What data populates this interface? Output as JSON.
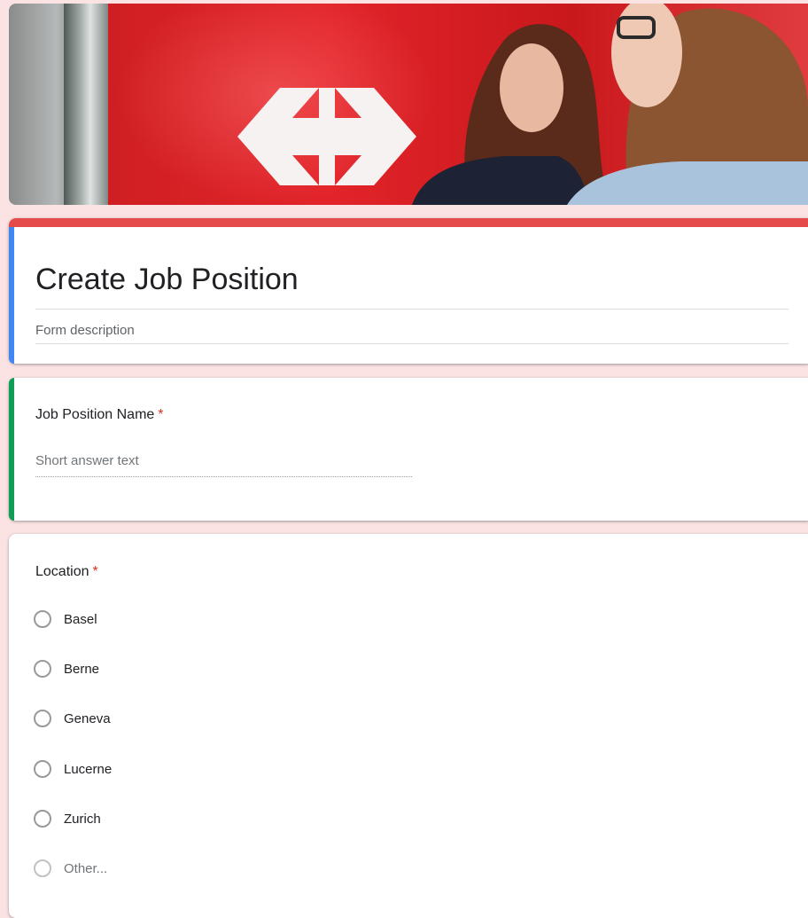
{
  "header": {
    "image_name": "header-image"
  },
  "form": {
    "title": "Create Job Position",
    "description_placeholder": "Form description",
    "accent_colors": {
      "title_top_bar": "#e54b4b",
      "title_left_bar": "#4285f4",
      "question_left_bar": "#0f9d58",
      "required_star": "#d93025",
      "background": "#fbe3e3"
    }
  },
  "questions": [
    {
      "title": "Job Position Name",
      "required_mark": "*",
      "type": "short-answer",
      "placeholder": "Short answer text"
    },
    {
      "title": "Location",
      "required_mark": "*",
      "type": "multiple-choice",
      "options": [
        "Basel",
        "Berne",
        "Geneva",
        "Lucerne",
        "Zurich",
        "Other..."
      ]
    }
  ]
}
